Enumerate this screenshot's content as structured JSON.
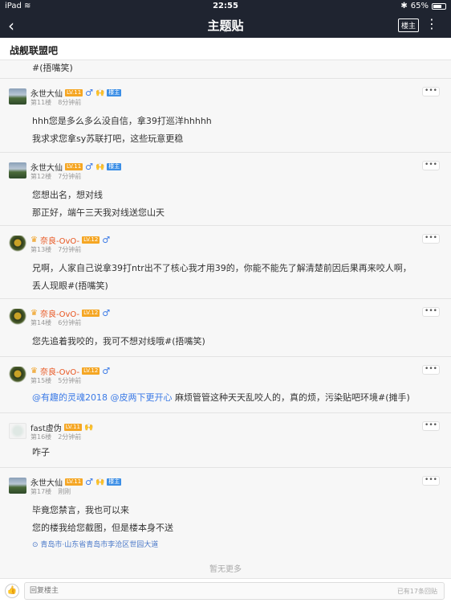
{
  "status_bar": {
    "device": "iPad",
    "time": "22:55",
    "battery": "65%"
  },
  "nav": {
    "title": "主题贴",
    "owner_only": "楼主"
  },
  "forum": {
    "name": "战舰联盟吧"
  },
  "partial_text": "#(捂嘴笑)",
  "posts": [
    {
      "user": "永世大仙",
      "level": "LV.11",
      "owner_badge": "楼主",
      "floor": "第11楼",
      "time": "8分钟前",
      "lines": [
        "hhh您是多么多么没自信，拿39打巡洋hhhhh",
        "我求求您拿sy苏联打吧，这些玩意更稳"
      ]
    },
    {
      "user": "永世大仙",
      "level": "LV.11",
      "owner_badge": "楼主",
      "floor": "第12楼",
      "time": "7分钟前",
      "lines": [
        "您想出名，想对线",
        "那正好，端午三天我对线送您山天"
      ]
    },
    {
      "user": "奈良-OvO-",
      "level": "LV.12",
      "floor": "第13楼",
      "time": "7分钟前",
      "lines": [
        "兄啊，人家自己说拿39打ntr出不了核心我才用39的，你能不能先了解清楚前因后果再来咬人啊，",
        "丢人现眼#(捂嘴笑)"
      ]
    },
    {
      "user": "奈良-OvO-",
      "level": "LV.12",
      "floor": "第14楼",
      "time": "6分钟前",
      "lines": [
        "您先追着我咬的，我可不想对线哦#(捂嘴笑)"
      ]
    },
    {
      "user": "奈良-OvO-",
      "level": "LV.12",
      "floor": "第15楼",
      "time": "5分钟前",
      "mentions": [
        "@有趣的灵魂2018",
        "@皮两下更开心"
      ],
      "lines": [
        " 麻烦管管这种天天乱咬人的，真的烦，污染贴吧环境#(摊手)"
      ]
    },
    {
      "user": "fast虚伪",
      "level": "LV.11",
      "floor": "第16楼",
      "time": "2分钟前",
      "lines": [
        "咋子"
      ]
    },
    {
      "user": "永世大仙",
      "level": "LV.11",
      "owner_badge": "楼主",
      "floor": "第17楼",
      "time": "刚刚",
      "lines": [
        "毕竟您禁言，我也可以来",
        "您的楼我给您截图，但是楼本身不送"
      ],
      "location": "青岛市·山东省青岛市李沧区世园大道"
    }
  ],
  "no_more": "暂无更多",
  "bottom": {
    "placeholder": "回复楼主",
    "reply_count": "已有17条回贴"
  },
  "colors": {
    "nav_bg": "#1f2430",
    "accent": "#3b7ae6",
    "level_badge": "#f5a623",
    "owner_badge": "#3b8ee6",
    "vip_name": "#e8541e"
  },
  "icons": [
    "back-arrow-icon",
    "kebab-icon",
    "male-icon",
    "fire-icon",
    "crown-icon",
    "more-dots-icon",
    "location-pin-icon",
    "thumb-up-icon"
  ]
}
